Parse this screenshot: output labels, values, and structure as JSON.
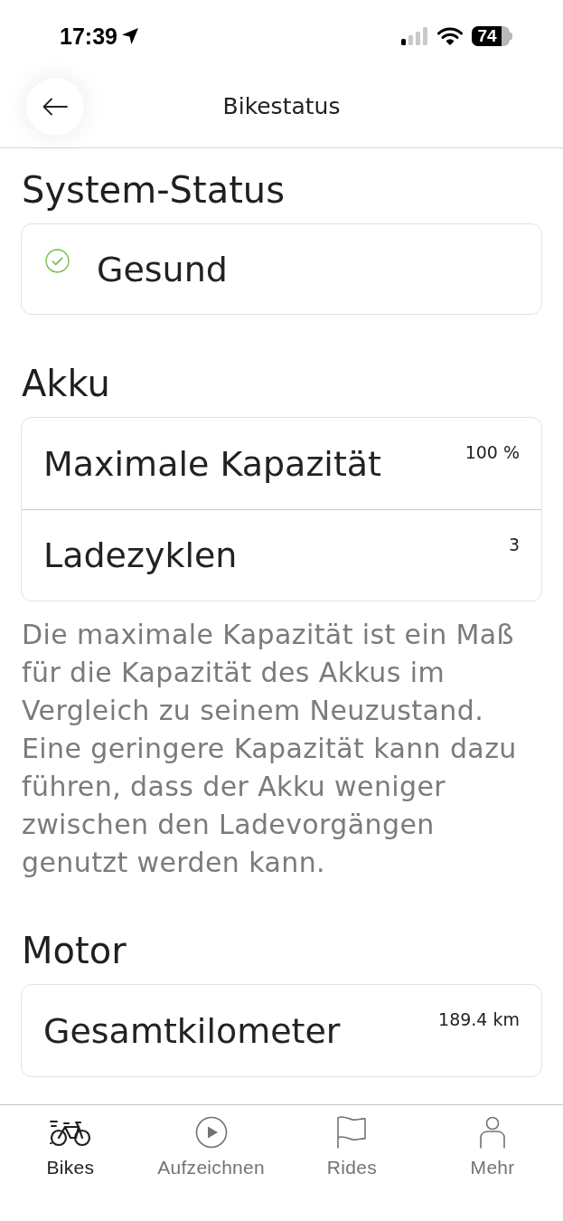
{
  "status_bar": {
    "time": "17:39",
    "battery": "74"
  },
  "header": {
    "title": "Bikestatus"
  },
  "sections": [
    {
      "heading": "System-Status",
      "status": {
        "kind": "ok",
        "label": "Gesund"
      }
    },
    {
      "heading": "Akku",
      "rows": [
        {
          "label": "Maximale Kapazität",
          "value": "100 %"
        },
        {
          "label": "Ladezyklen",
          "value": "3"
        }
      ],
      "note": "Die maximale Kapazität ist ein Maß für die Kapazität des Akkus im Vergleich zu seinem Neuzustand. Eine geringere Kapazität kann dazu führen, dass der Akku weniger zwischen den Ladevorgängen genutzt werden kann."
    },
    {
      "heading": "Motor",
      "rows": [
        {
          "label": "Gesamtkilometer",
          "value": "189.4 km"
        }
      ]
    }
  ],
  "tab_bar": [
    {
      "label": "Bikes",
      "selected": true
    },
    {
      "label": "Aufzeichnen",
      "selected": false
    },
    {
      "label": "Rides",
      "selected": false
    },
    {
      "label": "Mehr",
      "selected": false
    }
  ]
}
